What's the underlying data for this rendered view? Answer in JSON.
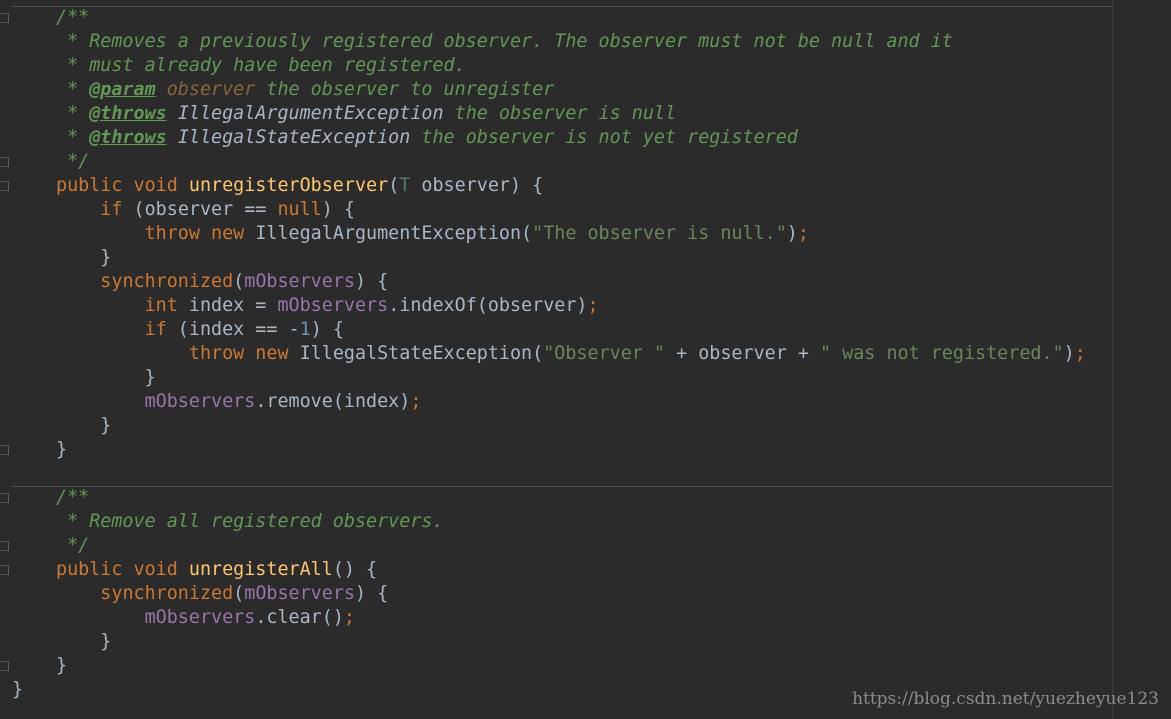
{
  "editor": {
    "colors": {
      "background": "#2b2b2b",
      "plain": "#a9b7c6",
      "keyword": "#cc7832",
      "function": "#ffc66d",
      "field": "#9876aa",
      "string": "#6a8759",
      "number": "#6897bb",
      "doc_comment": "#629755",
      "type_param": "#507874",
      "param_name": "#8a653b"
    },
    "lines": [
      {
        "tokens": [
          {
            "t": "/**",
            "c": "doc"
          }
        ]
      },
      {
        "tokens": [
          {
            "t": " * Removes a previously registered observer. The observer must not be null and it",
            "c": "doc"
          }
        ]
      },
      {
        "tokens": [
          {
            "t": " * must already have been registered.",
            "c": "doc"
          }
        ]
      },
      {
        "tokens": [
          {
            "t": " * ",
            "c": "doc"
          },
          {
            "t": "@param",
            "c": "tag"
          },
          {
            "t": " ",
            "c": "doc"
          },
          {
            "t": "observer",
            "c": "pname"
          },
          {
            "t": " the observer to unregister",
            "c": "doc"
          }
        ]
      },
      {
        "tokens": [
          {
            "t": " * ",
            "c": "doc"
          },
          {
            "t": "@throws",
            "c": "tag"
          },
          {
            "t": " ",
            "c": "doc"
          },
          {
            "t": "IllegalArgumentException",
            "c": "cls"
          },
          {
            "t": " the observer is null",
            "c": "doc"
          }
        ]
      },
      {
        "tokens": [
          {
            "t": " * ",
            "c": "doc"
          },
          {
            "t": "@throws",
            "c": "tag"
          },
          {
            "t": " ",
            "c": "doc"
          },
          {
            "t": "IllegalStateException",
            "c": "cls"
          },
          {
            "t": " the observer is not yet registered",
            "c": "doc"
          }
        ]
      },
      {
        "tokens": [
          {
            "t": " */",
            "c": "doc"
          }
        ]
      },
      {
        "tokens": [
          {
            "t": "public void ",
            "c": "kw"
          },
          {
            "t": "unregisterObserver",
            "c": "fn"
          },
          {
            "t": "(",
            "c": "plain"
          },
          {
            "t": "T",
            "c": "type"
          },
          {
            "t": " observer) {",
            "c": "plain"
          }
        ]
      },
      {
        "tokens": [
          {
            "t": "    ",
            "c": "plain"
          },
          {
            "t": "if",
            "c": "kw"
          },
          {
            "t": " (observer == ",
            "c": "plain"
          },
          {
            "t": "null",
            "c": "kw"
          },
          {
            "t": ") {",
            "c": "plain"
          }
        ]
      },
      {
        "tokens": [
          {
            "t": "        ",
            "c": "plain"
          },
          {
            "t": "throw new ",
            "c": "kw"
          },
          {
            "t": "IllegalArgumentException(",
            "c": "plain"
          },
          {
            "t": "\"The observer is null.\"",
            "c": "str"
          },
          {
            "t": ")",
            "c": "plain"
          },
          {
            "t": ";",
            "c": "punc"
          }
        ]
      },
      {
        "tokens": [
          {
            "t": "    }",
            "c": "plain"
          }
        ]
      },
      {
        "tokens": [
          {
            "t": "    ",
            "c": "plain"
          },
          {
            "t": "synchronized",
            "c": "kw"
          },
          {
            "t": "(",
            "c": "plain"
          },
          {
            "t": "mObservers",
            "c": "field"
          },
          {
            "t": ") {",
            "c": "plain"
          }
        ]
      },
      {
        "tokens": [
          {
            "t": "        ",
            "c": "plain"
          },
          {
            "t": "int ",
            "c": "kw"
          },
          {
            "t": "index = ",
            "c": "plain"
          },
          {
            "t": "mObservers",
            "c": "field"
          },
          {
            "t": ".indexOf(observer)",
            "c": "plain"
          },
          {
            "t": ";",
            "c": "punc"
          }
        ]
      },
      {
        "tokens": [
          {
            "t": "        ",
            "c": "plain"
          },
          {
            "t": "if",
            "c": "kw"
          },
          {
            "t": " (index == -",
            "c": "plain"
          },
          {
            "t": "1",
            "c": "num"
          },
          {
            "t": ") {",
            "c": "plain"
          }
        ]
      },
      {
        "tokens": [
          {
            "t": "            ",
            "c": "plain"
          },
          {
            "t": "throw new ",
            "c": "kw"
          },
          {
            "t": "IllegalStateException(",
            "c": "plain"
          },
          {
            "t": "\"Observer \"",
            "c": "str"
          },
          {
            "t": " + observer + ",
            "c": "plain"
          },
          {
            "t": "\" was not registered.\"",
            "c": "str"
          },
          {
            "t": ")",
            "c": "plain"
          },
          {
            "t": ";",
            "c": "punc"
          }
        ]
      },
      {
        "tokens": [
          {
            "t": "        }",
            "c": "plain"
          }
        ]
      },
      {
        "tokens": [
          {
            "t": "        ",
            "c": "plain"
          },
          {
            "t": "mObservers",
            "c": "field"
          },
          {
            "t": ".remove(index)",
            "c": "plain"
          },
          {
            "t": ";",
            "c": "punc"
          }
        ]
      },
      {
        "tokens": [
          {
            "t": "    }",
            "c": "plain"
          }
        ]
      },
      {
        "tokens": [
          {
            "t": "}",
            "c": "plain"
          }
        ]
      },
      {
        "tokens": []
      },
      {
        "tokens": [
          {
            "t": "/**",
            "c": "doc"
          }
        ]
      },
      {
        "tokens": [
          {
            "t": " * Remove all registered observers.",
            "c": "doc"
          }
        ]
      },
      {
        "tokens": [
          {
            "t": " */",
            "c": "doc"
          }
        ]
      },
      {
        "tokens": [
          {
            "t": "public void ",
            "c": "kw"
          },
          {
            "t": "unregisterAll",
            "c": "fn"
          },
          {
            "t": "() {",
            "c": "plain"
          }
        ]
      },
      {
        "tokens": [
          {
            "t": "    ",
            "c": "plain"
          },
          {
            "t": "synchronized",
            "c": "kw"
          },
          {
            "t": "(",
            "c": "plain"
          },
          {
            "t": "mObservers",
            "c": "field"
          },
          {
            "t": ") {",
            "c": "plain"
          }
        ]
      },
      {
        "tokens": [
          {
            "t": "        ",
            "c": "plain"
          },
          {
            "t": "mObservers",
            "c": "field"
          },
          {
            "t": ".clear()",
            "c": "plain"
          },
          {
            "t": ";",
            "c": "punc"
          }
        ]
      },
      {
        "tokens": [
          {
            "t": "    }",
            "c": "plain"
          }
        ]
      },
      {
        "tokens": [
          {
            "t": "}",
            "c": "plain"
          }
        ]
      },
      {
        "tokens": [
          {
            "t": "}",
            "c": "plain"
          }
        ]
      }
    ]
  },
  "watermark": {
    "text": "https://blog.csdn.net/yuezheyue123"
  }
}
